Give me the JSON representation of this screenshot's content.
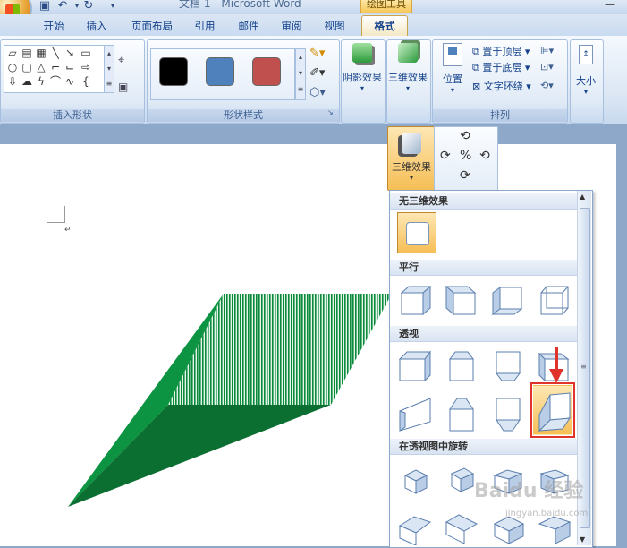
{
  "title": "文档 1 - Microsoft Word",
  "context_tab_group": "绘图工具",
  "tabs": [
    {
      "label": "开始",
      "active": false
    },
    {
      "label": "插入",
      "active": false
    },
    {
      "label": "页面布局",
      "active": false
    },
    {
      "label": "引用",
      "active": false
    },
    {
      "label": "邮件",
      "active": false
    },
    {
      "label": "审阅",
      "active": false
    },
    {
      "label": "视图",
      "active": false
    },
    {
      "label": "格式",
      "active": true
    }
  ],
  "ribbon": {
    "insert_shapes_label": "插入形状",
    "shape_styles_label": "形状样式",
    "shape_style_swatches": [
      "#000000",
      "#4f81bd",
      "#c0504d"
    ],
    "shadow_effects": "阴影效果",
    "threed_effects": "三维效果",
    "position": "位置",
    "bring_to_front": "置于顶层",
    "send_to_back": "置于底层",
    "text_wrap": "文字环绕",
    "arrange_label": "排列",
    "size": "大小"
  },
  "dropdown": {
    "button_label": "三维效果",
    "categories": {
      "none": "无三维效果",
      "parallel": "平行",
      "perspective": "透视",
      "rotate_perspective": "在透视图中旋转"
    }
  },
  "colors": {
    "shape_fill": "#0b8a3e",
    "shape_dark": "#0a6f31",
    "highlight": "#e0332c",
    "accent": "#f6be56"
  },
  "watermark": "Baidu 经验",
  "watermark_sub": "jingyan.baidu.com"
}
